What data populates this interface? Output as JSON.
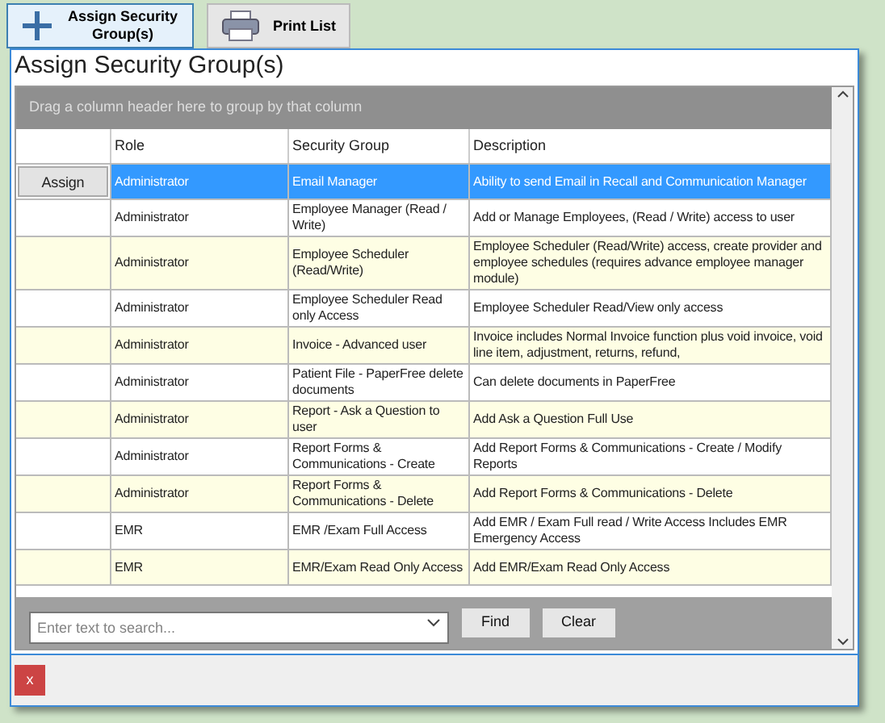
{
  "toolbar": [
    {
      "kind": "plus",
      "label": "Assign Security Group(s)",
      "selected": true
    },
    {
      "kind": "printer",
      "label": "Print List",
      "selected": false
    }
  ],
  "dialog": {
    "title": "Assign Security Group(s)",
    "group_panel": "Drag a column header here to group by that column",
    "table": {
      "columns": [
        "Role",
        "Security Group",
        "Description"
      ],
      "rows": [
        {
          "action": "Assign",
          "selected": true,
          "cells": [
            "Administrator",
            "Email Manager",
            "Ability to send Email in Recall and Communication Manager"
          ]
        },
        {
          "selected": false,
          "cells": [
            "Administrator",
            "Employee Manager (Read / Write)",
            "Add or Manage Employees, (Read / Write) access to user"
          ]
        },
        {
          "selected": false,
          "cells": [
            "Administrator",
            "Employee Scheduler (Read/Write)",
            "Employee Scheduler (Read/Write) access, create provider and employee schedules (requires advance employee manager module)"
          ]
        },
        {
          "selected": false,
          "cells": [
            "Administrator",
            "Employee Scheduler Read only Access",
            "Employee Scheduler Read/View only access"
          ]
        },
        {
          "selected": false,
          "cells": [
            "Administrator",
            "Invoice - Advanced user",
            "Invoice  includes Normal Invoice function plus void invoice, void line item, adjustment, returns, refund,"
          ]
        },
        {
          "selected": false,
          "cells": [
            "Administrator",
            "Patient File - PaperFree delete documents",
            "Can delete documents in PaperFree"
          ]
        },
        {
          "selected": false,
          "cells": [
            "Administrator",
            "Report - Ask a Question to user",
            "Add Ask a Question Full Use"
          ]
        },
        {
          "selected": false,
          "cells": [
            "Administrator",
            "Report Forms & Communications - Create",
            "Add Report Forms & Communications - Create / Modify Reports"
          ]
        },
        {
          "selected": false,
          "cells": [
            "Administrator",
            "Report Forms & Communications - Delete",
            "Add Report Forms & Communications - Delete"
          ]
        },
        {
          "selected": false,
          "cells": [
            "EMR",
            "EMR /Exam Full Access",
            "Add EMR / Exam Full read / Write Access Includes EMR Emergency Access"
          ]
        },
        {
          "selected": false,
          "cells": [
            "EMR",
            "EMR/Exam Read Only Access",
            "Add EMR/Exam Read Only Access"
          ]
        }
      ]
    },
    "search": {
      "placeholder": "Enter text to search..."
    },
    "buttons": [
      "Find",
      "Clear"
    ],
    "close_button": "x"
  }
}
